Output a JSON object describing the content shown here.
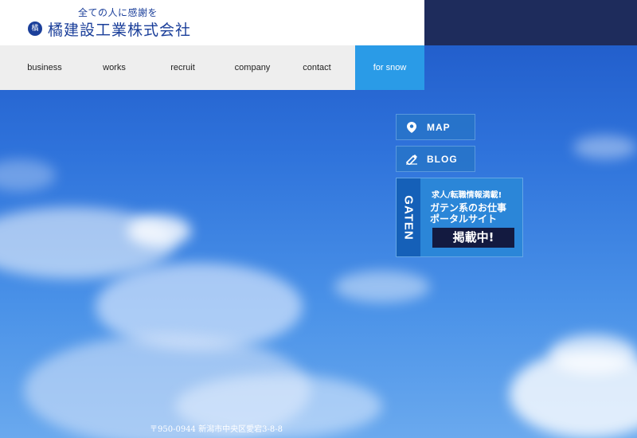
{
  "header": {
    "tagline": "全ての人に感謝を",
    "logo_mark": "橘",
    "company_name": "橘建設工業株式会社"
  },
  "nav": {
    "items": [
      "business",
      "works",
      "recruit",
      "company",
      "contact",
      "for snow"
    ],
    "active": "for snow"
  },
  "side_links": {
    "map_label": "MAP",
    "blog_label": "BLOG"
  },
  "gaten_banner": {
    "logo": "GATEN",
    "line1": "求人/転職情報満載!",
    "line2": "ガテン系のお仕事",
    "line3": "ポータルサイト",
    "badge": "掲載中!"
  },
  "footer": {
    "address": "〒950-0944 新潟市中央区愛宕3-8-8"
  },
  "colors": {
    "brand": "#1b3f9a",
    "nav_active": "#2a9be7",
    "header_dark": "#1e2c5c"
  }
}
